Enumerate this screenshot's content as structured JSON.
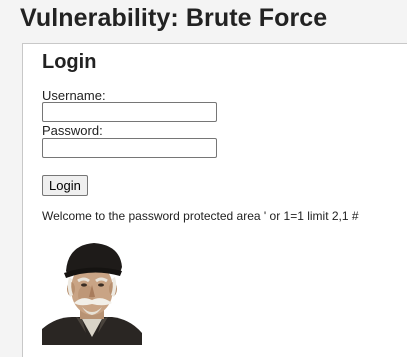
{
  "page": {
    "title": "Vulnerability: Brute Force"
  },
  "login": {
    "heading": "Login",
    "username_label": "Username:",
    "username_value": "",
    "password_label": "Password:",
    "password_value": "",
    "submit_label": "Login"
  },
  "result": {
    "message": "Welcome to the password protected area ' or 1=1 limit 2,1 #"
  },
  "photo": {
    "icon": "user-avatar-photo-icon"
  }
}
